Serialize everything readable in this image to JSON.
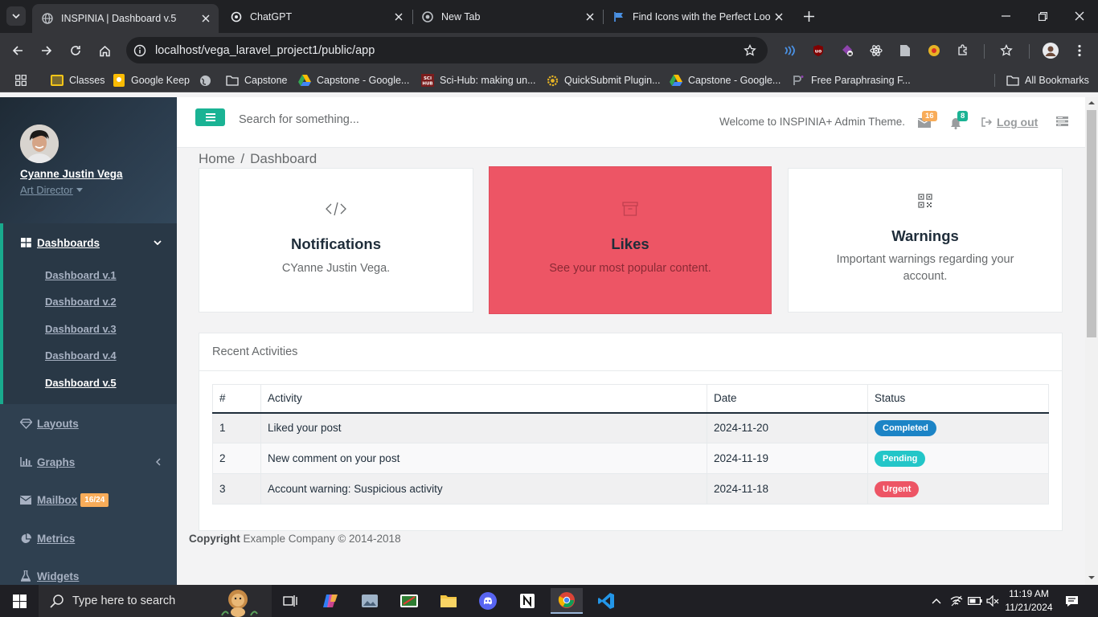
{
  "browser": {
    "tabs": [
      {
        "title": "INSPINIA | Dashboard v.5",
        "active": true
      },
      {
        "title": "ChatGPT",
        "active": false
      },
      {
        "title": "New Tab",
        "active": false
      },
      {
        "title": "Find Icons with the Perfect Look",
        "active": false
      }
    ],
    "url": "localhost/vega_laravel_project1/public/app",
    "bookmarks": [
      {
        "label": "Classes",
        "icon": "folder-icon"
      },
      {
        "label": "Google Keep",
        "icon": "keep-icon"
      },
      {
        "label": "",
        "icon": "globe-icon"
      },
      {
        "label": "Capstone",
        "icon": "folder-icon"
      },
      {
        "label": "Capstone - Google...",
        "icon": "drive-icon"
      },
      {
        "label": "Sci-Hub: making un...",
        "icon": "scihub-icon"
      },
      {
        "label": "QuickSubmit Plugin...",
        "icon": "gear-icon"
      },
      {
        "label": "Capstone - Google...",
        "icon": "drive-icon"
      },
      {
        "label": "Free Paraphrasing F...",
        "icon": "paraphrase-icon"
      }
    ],
    "all_bookmarks": "All Bookmarks"
  },
  "sidebar": {
    "user_name": "Cyanne Justin Vega",
    "user_role": "Art Director",
    "dashboards_label": "Dashboards",
    "dashboard_links": [
      "Dashboard v.1",
      "Dashboard v.2",
      "Dashboard v.3",
      "Dashboard v.4",
      "Dashboard v.5"
    ],
    "items": [
      {
        "label": "Layouts",
        "icon": "diamond-icon"
      },
      {
        "label": "Graphs",
        "icon": "bar-chart-icon"
      },
      {
        "label": "Mailbox",
        "icon": "envelope-icon",
        "badge": "16/24"
      },
      {
        "label": "Metrics",
        "icon": "pie-chart-icon"
      },
      {
        "label": "Widgets",
        "icon": "flask-icon"
      }
    ]
  },
  "topnav": {
    "search_placeholder": "Search for something...",
    "welcome": "Welcome to INSPINIA+ Admin Theme.",
    "messages_count": "16",
    "alerts_count": "8",
    "logout": "Log out"
  },
  "breadcrumb": {
    "home": "Home",
    "current": "Dashboard"
  },
  "cards": [
    {
      "title": "Notifications",
      "text": "CYanne Justin Vega.",
      "icon": "code-icon"
    },
    {
      "title": "Likes",
      "text": "See your most popular content.",
      "icon": "archive-icon"
    },
    {
      "title": "Warnings",
      "text": "Important warnings regarding your account.",
      "icon": "qrcode-icon"
    }
  ],
  "activities": {
    "title": "Recent Activities",
    "columns": [
      "#",
      "Activity",
      "Date",
      "Status"
    ],
    "rows": [
      {
        "num": "1",
        "activity": "Liked your post",
        "date": "2024-11-20",
        "status": "Completed",
        "color": "#1c84c6"
      },
      {
        "num": "2",
        "activity": "New comment on your post",
        "date": "2024-11-19",
        "status": "Pending",
        "color": "#23c6c8"
      },
      {
        "num": "3",
        "activity": "Account warning: Suspicious activity",
        "date": "2024-11-18",
        "status": "Urgent",
        "color": "#ed5565"
      }
    ]
  },
  "footer": {
    "bold": "Copyright",
    "text": "Example Company © 2014-2018"
  },
  "taskbar": {
    "search": "Type here to search",
    "time": "11:19 AM",
    "date": "11/21/2024"
  },
  "colors": {
    "accent": "#1ab394",
    "sidebar": "#2f4050",
    "likes_card": "#ed5565",
    "badge_orange": "#f8ac59"
  }
}
